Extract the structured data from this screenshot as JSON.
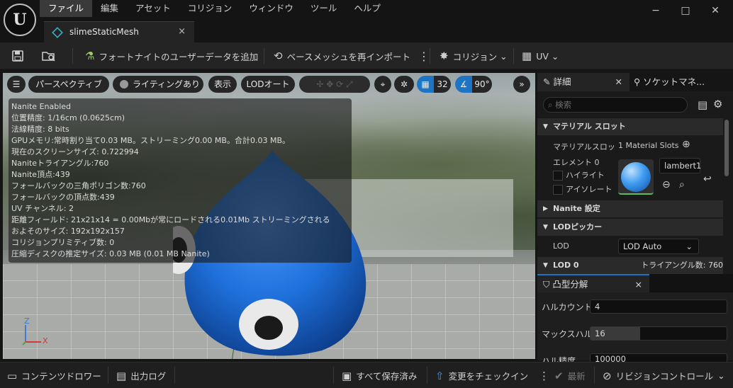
{
  "app": {
    "logo": "U",
    "menu": [
      "ファイル",
      "編集",
      "アセット",
      "コリジョン",
      "ウィンドウ",
      "ツール",
      "ヘルプ"
    ],
    "window_controls": {
      "minimize": "−",
      "maximize": "□",
      "close": "✕"
    },
    "asset_tab": {
      "label": "slimeStaticMesh",
      "close": "×"
    }
  },
  "toolbar": {
    "save_icon": "save-icon",
    "browse_icon": "browse-asset-icon",
    "fortnite_label": "フォートナイトのユーザーデータを追加",
    "reimport_label": "ベースメッシュを再インポート",
    "more": "⋮",
    "collision_label": "コリジョン",
    "uv_label": "UV"
  },
  "viewport": {
    "menu_icon": "☰",
    "perspective": "パースペクティブ",
    "lighting": "ライティングあり",
    "show": "表示",
    "lod": "LODオート",
    "grid_value": "32",
    "angle_value": "90°",
    "expand": "»",
    "stats": [
      "Nanite Enabled",
      "位置精度: 1/16cm (0.0625cm)",
      "法線精度: 8 bits",
      "GPUメモリ:常時割り当て0.03 MB。ストリーミング0.00 MB。合計0.03 MB。",
      "現在のスクリーンサイズ: 0.722994",
      "Naniteトライアングル:760",
      "Nanite頂点:439",
      "フォールバックの三角ポリゴン数:760",
      "フォールバックの頂点数:439",
      "UV チャンネル: 2",
      "距離フィールド: 21x21x14 = 0.00Mbが常にロードされる0.01Mb ストリーミングされる",
      "およそのサイズ: 192x192x157",
      "コリジョンプリミティブ数: 0",
      "圧縮ディスクの推定サイズ: 0.03 MB (0.01 MB Nanite)"
    ],
    "axis": {
      "z": "Z",
      "x": "X"
    }
  },
  "details_panel": {
    "tab_details": "詳細",
    "tab_sockets": "ソケットマネ...",
    "search_placeholder": "検索",
    "material_section": "マテリアル スロット",
    "material_slots_label": "マテリアルスロッ",
    "material_slots_value": "1 Material Slots",
    "element_label": "エレメント 0",
    "highlight_label": "ハイライト",
    "isolate_label": "アイソレート",
    "material_name": "lambert1",
    "nanite_section": "Nanite 設定",
    "lod_picker_section": "LODピッカー",
    "lod_label": "LOD",
    "lod_value": "LOD Auto",
    "lod0_section": "LOD 0",
    "triangle_count": "トライアングル数: 760"
  },
  "convex_panel": {
    "title": "凸型分解",
    "close": "×",
    "hull_count_label": "ハルカウント",
    "hull_count_value": "4",
    "max_hull_label": "マックスハル",
    "max_hull_value": "16",
    "hull_precision_label": "ハル精度",
    "hull_precision_value": "100000"
  },
  "statusbar": {
    "content_drawer": "コンテンツドロワー",
    "output_log": "出力ログ",
    "all_saved": "すべて保存済み",
    "check_in": "変更をチェックイン",
    "more": "⋮",
    "latest": "最新",
    "revision_control": "リビジョンコントロール"
  },
  "colors": {
    "accent": "#1d74c4",
    "panel": "#1a1a1a",
    "slime_blue": "#1e6fd9"
  }
}
